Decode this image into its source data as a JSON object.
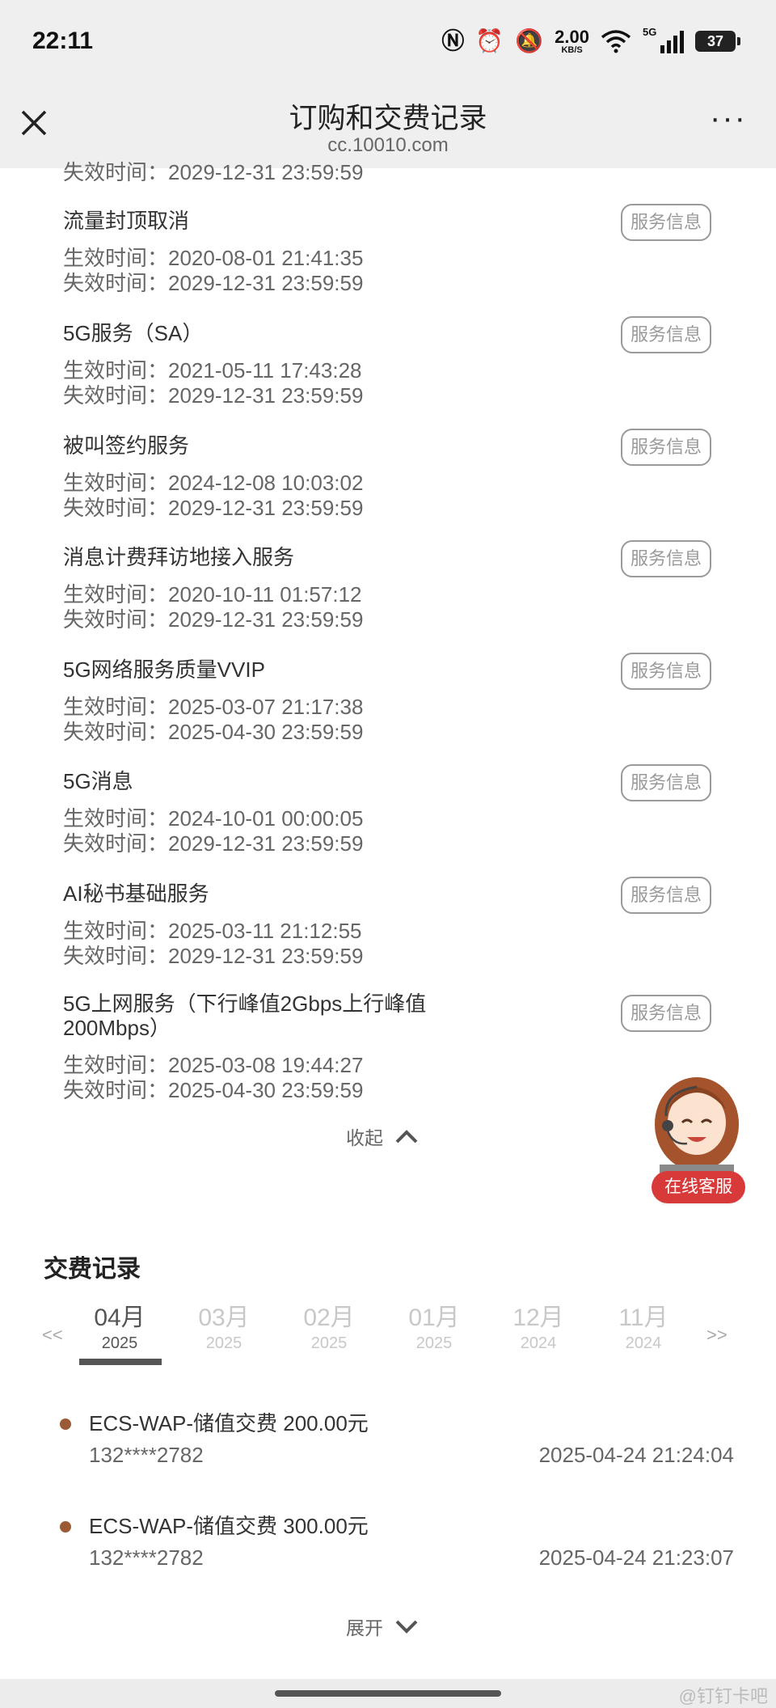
{
  "status_bar": {
    "time": "22:11",
    "speed_value": "2.00",
    "speed_unit": "KB/S",
    "network": "5G",
    "battery": "37"
  },
  "header": {
    "title": "订购和交费记录",
    "url": "cc.10010.com",
    "more_label": "···"
  },
  "partial_top": "失效时间：2029-12-31 23:59:59",
  "services": [
    {
      "name": "流量封顶取消",
      "start": "生效时间：2020-08-01 21:41:35",
      "end": "失效时间：2029-12-31 23:59:59",
      "button": "服务信息"
    },
    {
      "name": "5G服务（SA）",
      "start": "生效时间：2021-05-11 17:43:28",
      "end": "失效时间：2029-12-31 23:59:59",
      "button": "服务信息"
    },
    {
      "name": "被叫签约服务",
      "start": "生效时间：2024-12-08 10:03:02",
      "end": "失效时间：2029-12-31 23:59:59",
      "button": "服务信息"
    },
    {
      "name": "消息计费拜访地接入服务",
      "start": "生效时间：2020-10-11 01:57:12",
      "end": "失效时间：2029-12-31 23:59:59",
      "button": "服务信息"
    },
    {
      "name": "5G网络服务质量VVIP",
      "start": "生效时间：2025-03-07 21:17:38",
      "end": "失效时间：2025-04-30 23:59:59",
      "button": "服务信息"
    },
    {
      "name": "5G消息",
      "start": "生效时间：2024-10-01 00:00:05",
      "end": "失效时间：2029-12-31 23:59:59",
      "button": "服务信息"
    },
    {
      "name": "AI秘书基础服务",
      "start": "生效时间：2025-03-11 21:12:55",
      "end": "失效时间：2029-12-31 23:59:59",
      "button": "服务信息"
    },
    {
      "name": "5G上网服务（下行峰值2Gbps上行峰值\n200Mbps）",
      "start": "生效时间：2025-03-08 19:44:27",
      "end": "失效时间：2025-04-30 23:59:59",
      "button": "服务信息"
    }
  ],
  "collapse_label": "收起",
  "agent_label": "在线客服",
  "payment_section": {
    "title": "交费记录",
    "prev": "<<",
    "next": ">>",
    "months": [
      {
        "month": "04月",
        "year": "2025",
        "active": true
      },
      {
        "month": "03月",
        "year": "2025"
      },
      {
        "month": "02月",
        "year": "2025"
      },
      {
        "month": "01月",
        "year": "2025"
      },
      {
        "month": "12月",
        "year": "2024"
      },
      {
        "month": "11月",
        "year": "2024"
      }
    ],
    "records": [
      {
        "desc": "ECS-WAP-储值交费 200.00元",
        "phone": "132****2782",
        "time": "2025-04-24 21:24:04"
      },
      {
        "desc": "ECS-WAP-储值交费 300.00元",
        "phone": "132****2782",
        "time": "2025-04-24 21:23:07"
      }
    ],
    "expand_label": "展开"
  },
  "watermark": "@钉钉卡吧",
  "colors": {
    "header_bg": "#efefef",
    "accent_dot": "#9b5a36",
    "agent_badge": "#d83a3a"
  }
}
